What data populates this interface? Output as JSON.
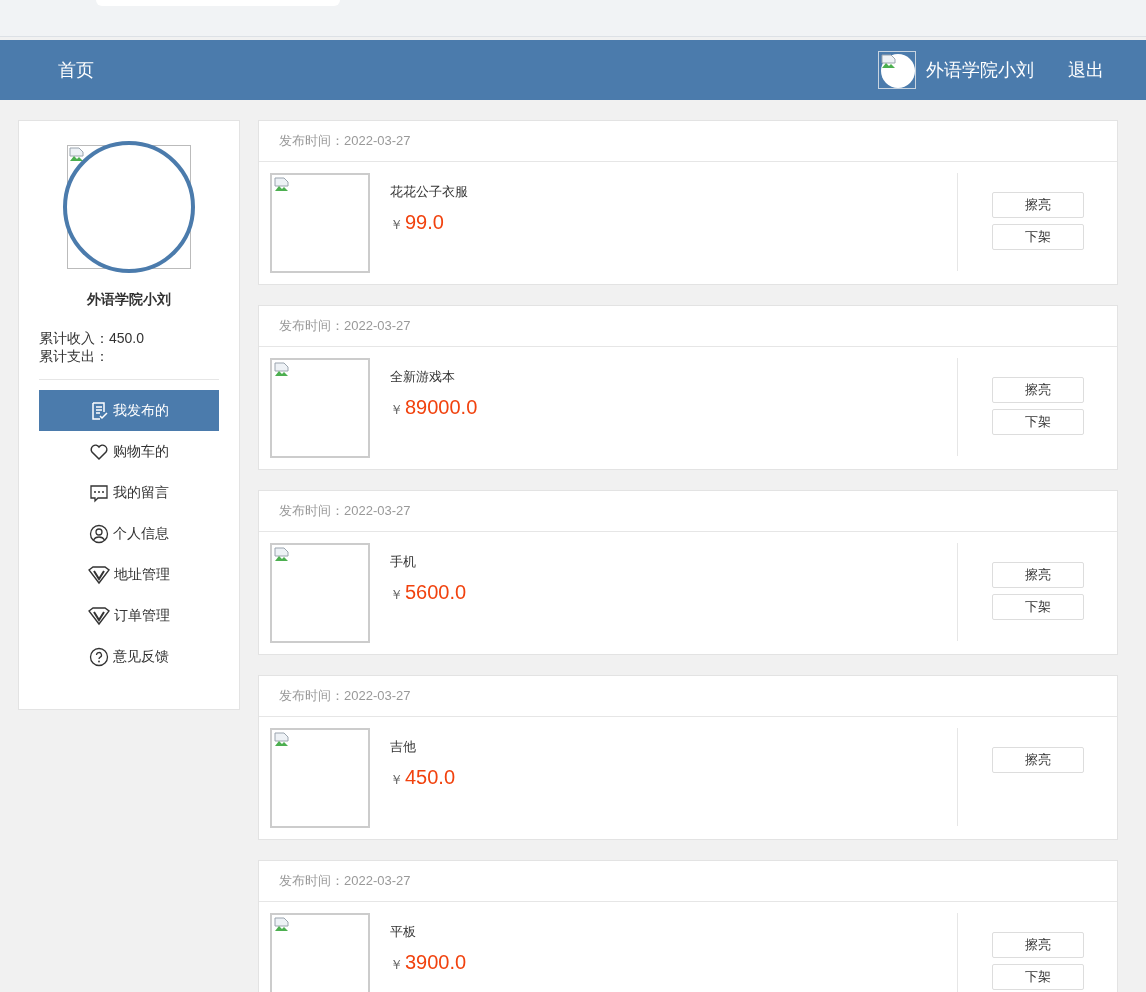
{
  "header": {
    "home": "首页",
    "user_name": "外语学院小刘",
    "logout": "退出"
  },
  "profile": {
    "name": "外语学院小刘",
    "income": "累计收入：450.0",
    "expense": "累计支出："
  },
  "menu": [
    {
      "label": "我发布的",
      "kind": "document",
      "selected": true
    },
    {
      "label": "购物车的",
      "kind": "heart",
      "selected": false
    },
    {
      "label": "我的留言",
      "kind": "chat",
      "selected": false
    },
    {
      "label": "个人信息",
      "kind": "user",
      "selected": false
    },
    {
      "label": "地址管理",
      "kind": "diamond",
      "selected": false
    },
    {
      "label": "订单管理",
      "kind": "diamond",
      "selected": false
    },
    {
      "label": "意见反馈",
      "kind": "question",
      "selected": false
    }
  ],
  "items": [
    {
      "published": "发布时间：2022-03-27",
      "title": "花花公子衣服",
      "currency": "￥",
      "price": "99.0",
      "actions": [
        "擦亮",
        "下架"
      ]
    },
    {
      "published": "发布时间：2022-03-27",
      "title": "全新游戏本",
      "currency": "￥",
      "price": "89000.0",
      "actions": [
        "擦亮",
        "下架"
      ]
    },
    {
      "published": "发布时间：2022-03-27",
      "title": "手机",
      "currency": "￥",
      "price": "5600.0",
      "actions": [
        "擦亮",
        "下架"
      ]
    },
    {
      "published": "发布时间：2022-03-27",
      "title": "吉他",
      "currency": "￥",
      "price": "450.0",
      "actions": [
        "擦亮"
      ]
    },
    {
      "published": "发布时间：2022-03-27",
      "title": "平板",
      "currency": "￥",
      "price": "3900.0",
      "actions": [
        "擦亮",
        "下架"
      ]
    }
  ]
}
